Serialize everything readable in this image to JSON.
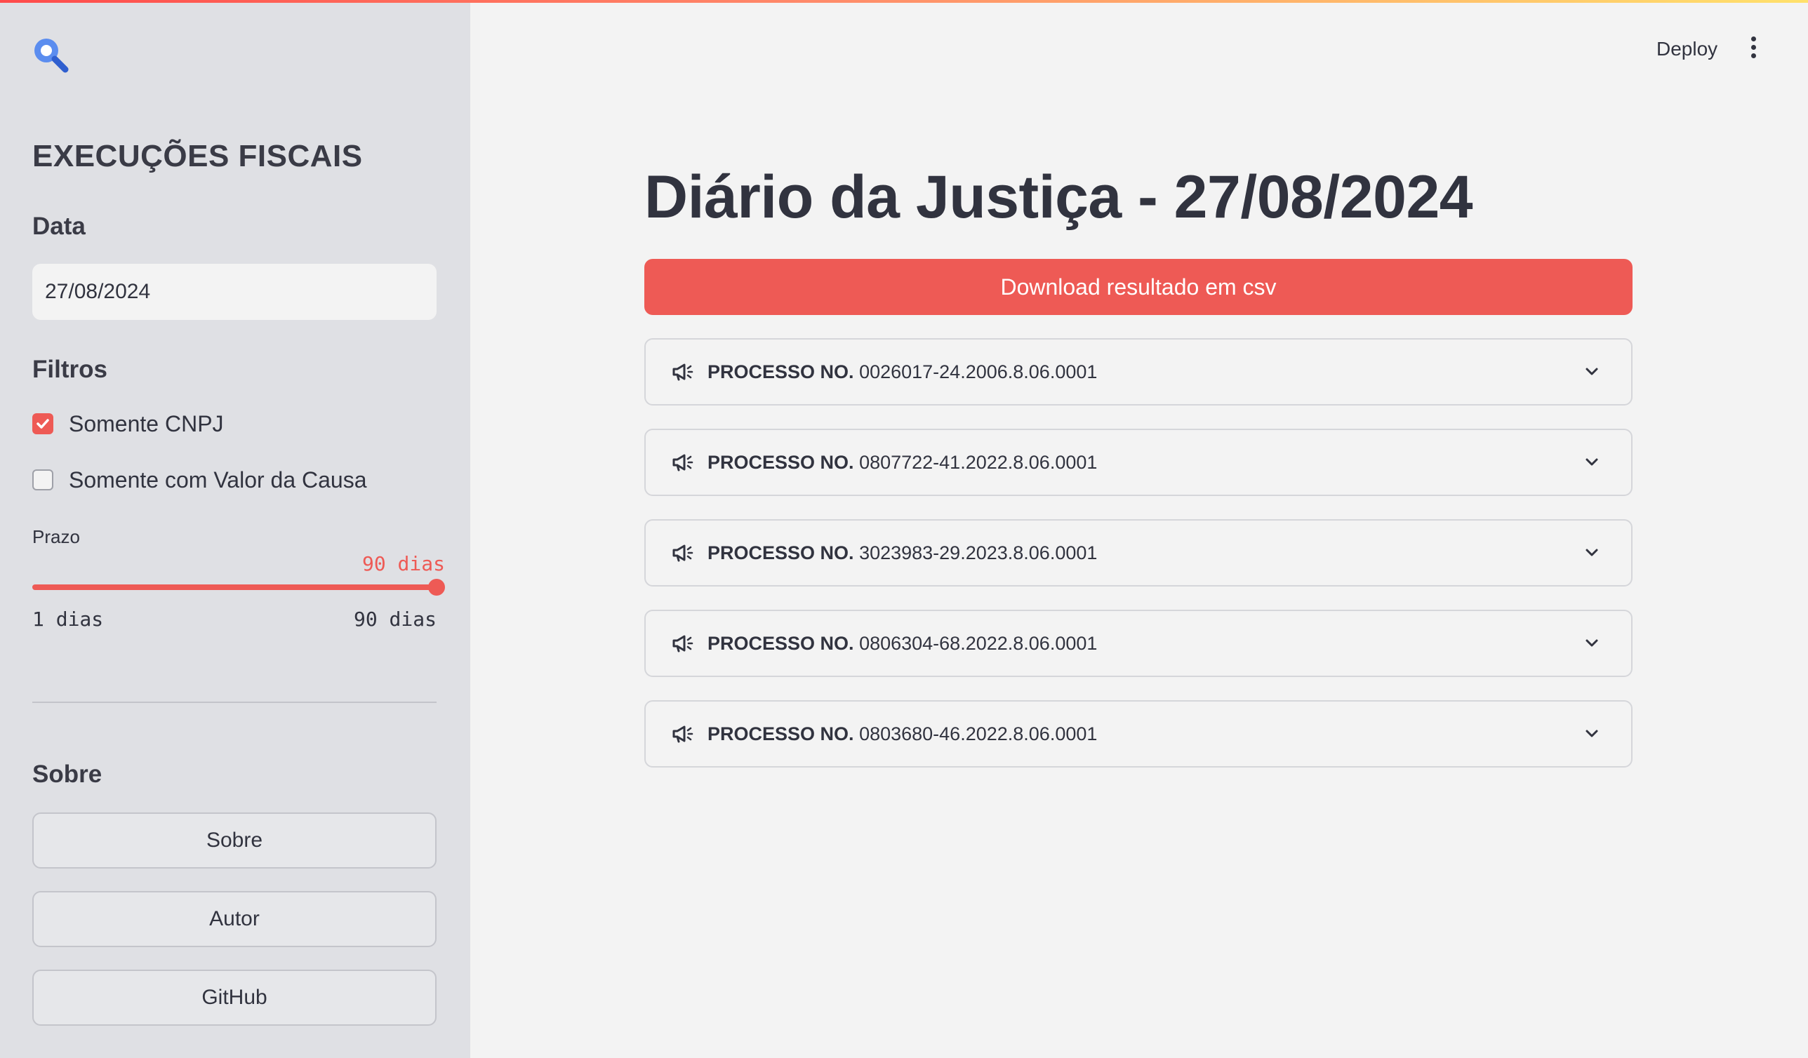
{
  "sidebar": {
    "title": "EXECUÇÕES FISCAIS",
    "date_section": "Data",
    "date_value": "27/08/2024",
    "filters_section": "Filtros",
    "checkboxes": [
      {
        "label": "Somente CNPJ",
        "checked": true
      },
      {
        "label": "Somente com Valor da Causa",
        "checked": false
      }
    ],
    "slider": {
      "label": "Prazo",
      "value_text": "90 dias",
      "value": 90,
      "min": 1,
      "max": 90,
      "min_text": "1 dias",
      "max_text": "90 dias"
    },
    "about_section": "Sobre",
    "buttons": [
      "Sobre",
      "Autor",
      "GitHub"
    ]
  },
  "header": {
    "deploy_label": "Deploy",
    "menu_icon": "more-vertical-icon"
  },
  "main": {
    "title": "Diário da Justiça - 27/08/2024",
    "download_label": "Download resultado em csv",
    "processes": [
      {
        "prefix": "PROCESSO NO.",
        "number": "0026017-24.2006.8.06.0001"
      },
      {
        "prefix": "PROCESSO NO.",
        "number": "0807722-41.2022.8.06.0001"
      },
      {
        "prefix": "PROCESSO NO.",
        "number": "3023983-29.2023.8.06.0001"
      },
      {
        "prefix": "PROCESSO NO.",
        "number": "0806304-68.2022.8.06.0001"
      },
      {
        "prefix": "PROCESSO NO.",
        "number": "0803680-46.2022.8.06.0001"
      }
    ]
  },
  "colors": {
    "accent": "#ee5a55",
    "sidebar_bg": "#dfe0e4",
    "main_bg": "#f3f3f3",
    "text": "#31333f",
    "logo_blue": "#5b8def"
  }
}
